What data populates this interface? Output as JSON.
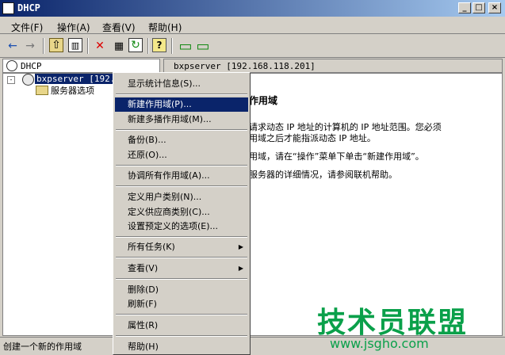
{
  "window": {
    "title": "DHCP",
    "min": "_",
    "max": "□",
    "close": "×"
  },
  "menubar": [
    "文件(F)",
    "操作(A)",
    "查看(V)",
    "帮助(H)"
  ],
  "toolbar": {
    "back": "←",
    "forward": "→",
    "up": "⇧",
    "show_tree": "▥",
    "delete": "✕",
    "properties": "▦",
    "refresh": "↻",
    "help": "?",
    "console1": "▭",
    "console2": "▭"
  },
  "tree": {
    "header": "DHCP",
    "server": "bxpserver [192.1",
    "options": "服务器选项"
  },
  "right": {
    "header": "bxpserver [192.168.118.201]",
    "heading": "作用域",
    "lines": [
      "请求动态 IP 地址的计算机的 IP 地址范围。您必须",
      "用域之后才能指派动态 IP 地址。",
      "用域，请在“操作”菜单下单击“新建作用域”。",
      "服务器的详细情况，请参阅联机帮助。"
    ]
  },
  "context_menu": [
    "显示统计信息(S)...",
    "新建作用域(P)...",
    "新建多播作用域(M)...",
    "备份(B)...",
    "还原(O)...",
    "协调所有作用域(A)...",
    "定义用户类别(N)...",
    "定义供应商类别(C)...",
    "设置预定义的选项(E)...",
    "所有任务(K)",
    "查看(V)",
    "删除(D)",
    "刷新(F)",
    "属性(R)",
    "帮助(H)"
  ],
  "status": "创建一个新的作用域",
  "watermark": {
    "main": "技术员联盟",
    "url": "www.jsgho.com"
  },
  "colors": {
    "titlebar": "#0a246a",
    "highlight": "#0a246a",
    "face": "#d4d0c8",
    "watermark": "#0aa04a"
  }
}
